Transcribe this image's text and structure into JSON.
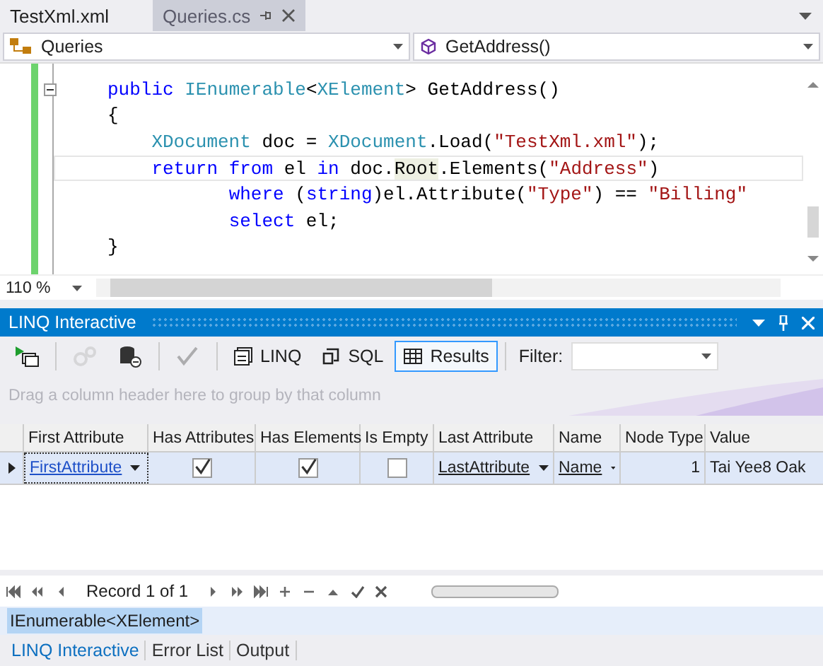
{
  "doc_tabs": [
    {
      "label": "TestXml.xml",
      "selected": false
    },
    {
      "label": "Queries.cs",
      "selected": true
    }
  ],
  "nav": {
    "type": "Queries",
    "member": "GetAddress()"
  },
  "code_lines": [
    {
      "fold": true,
      "tokens": [
        {
          "t": "public ",
          "kind": "keyword"
        },
        {
          "t": "IEnumerable",
          "kind": "type"
        },
        {
          "t": "<",
          "kind": "plain"
        },
        {
          "t": "XElement",
          "kind": "type"
        },
        {
          "t": "> GetAddress()",
          "kind": "plain"
        }
      ]
    },
    {
      "fold": false,
      "tokens": [
        {
          "t": "{",
          "kind": "plain"
        }
      ],
      "children": [
        {
          "fold": false,
          "tokens": [
            {
              "t": "XDocument",
              "kind": "type"
            },
            {
              "t": " doc = ",
              "kind": "plain"
            },
            {
              "t": "XDocument",
              "kind": "type"
            },
            {
              "t": ".Load(",
              "kind": "plain"
            },
            {
              "t": "\"TestXml.xml\"",
              "kind": "string"
            },
            {
              "t": ");",
              "kind": "plain"
            }
          ]
        },
        {
          "fold": false,
          "current": true,
          "tokens": [
            {
              "t": "return ",
              "kind": "keyword"
            },
            {
              "t": "from ",
              "kind": "keyword"
            },
            {
              "t": "el ",
              "kind": "plain"
            },
            {
              "t": "in ",
              "kind": "keyword"
            },
            {
              "t": "doc.",
              "kind": "plain"
            },
            {
              "t": "Root",
              "kind": "reference"
            },
            {
              "t": ".Elements(",
              "kind": "plain"
            },
            {
              "t": "\"Address\"",
              "kind": "string"
            },
            {
              "t": ")",
              "kind": "plain"
            }
          ],
          "children": [
            {
              "fold": false,
              "tokens": [
                {
                  "t": "where ",
                  "kind": "keyword"
                },
                {
                  "t": "(",
                  "kind": "plain"
                },
                {
                  "t": "string",
                  "kind": "keyword"
                },
                {
                  "t": ")el.Attribute(",
                  "kind": "plain"
                },
                {
                  "t": "\"Type\"",
                  "kind": "string"
                },
                {
                  "t": ") == ",
                  "kind": "plain"
                },
                {
                  "t": "\"Billing\"",
                  "kind": "string"
                }
              ]
            },
            {
              "fold": false,
              "tokens": [
                {
                  "t": "select ",
                  "kind": "keyword"
                },
                {
                  "t": "el;",
                  "kind": "plain"
                }
              ]
            }
          ]
        }
      ]
    },
    {
      "fold": false,
      "tokens": [
        {
          "t": "}",
          "kind": "plain"
        }
      ]
    }
  ],
  "zoom": "110 %",
  "panel": {
    "title": "LINQ Interactive"
  },
  "toolbar": [
    {
      "kind": "run",
      "disabled": false,
      "selected": false
    },
    {
      "kind": "sep"
    },
    {
      "kind": "gears",
      "disabled": true,
      "selected": false
    },
    {
      "kind": "db",
      "disabled": false,
      "selected": false
    },
    {
      "kind": "sep"
    },
    {
      "kind": "check",
      "disabled": true,
      "selected": false
    },
    {
      "kind": "sep"
    },
    {
      "kind": "linq",
      "label": "LINQ",
      "disabled": false,
      "selected": false
    },
    {
      "kind": "sql",
      "label": "SQL",
      "disabled": false,
      "selected": false
    },
    {
      "kind": "results",
      "label": "Results",
      "disabled": false,
      "selected": true
    },
    {
      "kind": "sep"
    }
  ],
  "filter": {
    "label": "Filter:"
  },
  "group_hint": "Drag a column header here to group by that column",
  "table": {
    "columns": [
      "First Attribute",
      "Has Attributes",
      "Has Elements",
      "Is Empty",
      "Last Attribute",
      "Name",
      "Node Type",
      "Value"
    ],
    "rows": [
      {
        "cells": [
          {
            "kind": "link",
            "text": "FirstAttribute"
          },
          {
            "kind": "check",
            "checked": true
          },
          {
            "kind": "check",
            "checked": true
          },
          {
            "kind": "check",
            "checked": false
          },
          {
            "kind": "dropdown",
            "text": "LastAttribute"
          },
          {
            "kind": "dropdown",
            "text": "Name"
          },
          {
            "kind": "number",
            "text": "1"
          },
          {
            "kind": "text",
            "text": "Tai Yee8 Oak"
          }
        ]
      }
    ]
  },
  "navigator": {
    "record": "Record 1 of 1",
    "buttons": [
      {
        "kind": "first"
      },
      {
        "kind": "prevpage"
      },
      {
        "kind": "prev"
      },
      {
        "kind": "record"
      },
      {
        "kind": "next"
      },
      {
        "kind": "nextpage"
      },
      {
        "kind": "last"
      },
      {
        "kind": "add"
      },
      {
        "kind": "remove"
      },
      {
        "kind": "up"
      },
      {
        "kind": "ok"
      },
      {
        "kind": "cancel"
      }
    ]
  },
  "result_type": "IEnumerable<XElement>",
  "bottom_tabs": [
    {
      "label": "LINQ Interactive",
      "selected": true
    },
    {
      "label": "Error List",
      "selected": false
    },
    {
      "label": "Output",
      "selected": false
    }
  ]
}
